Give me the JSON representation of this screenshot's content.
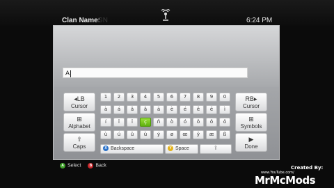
{
  "header": {
    "title": "Clan Name:",
    "ghost": "GN",
    "time": "6:24 PM"
  },
  "input": {
    "value": "A"
  },
  "sidebar_left": [
    {
      "icon": "◂LB",
      "label": "Cursor"
    },
    {
      "icon": "⊞",
      "label": "Alphabet"
    },
    {
      "icon": "⇧",
      "label": "Caps"
    }
  ],
  "sidebar_right": [
    {
      "icon": "RB▸",
      "label": "Cursor"
    },
    {
      "icon": "⊞",
      "label": "Symbols"
    },
    {
      "icon": "▶",
      "label": "Done"
    }
  ],
  "keys": [
    [
      "1",
      "2",
      "3",
      "4",
      "5",
      "6",
      "7",
      "8",
      "9",
      "0"
    ],
    [
      "à",
      "á",
      "â",
      "ã",
      "ä",
      "è",
      "é",
      "ê",
      "ë",
      "ì"
    ],
    [
      "í",
      "î",
      "ï",
      "ç",
      "ñ",
      "ò",
      "ó",
      "ô",
      "õ",
      "ö"
    ],
    [
      "ù",
      "ú",
      "û",
      "ü",
      "ý",
      "ø",
      "œ",
      "ÿ",
      "æ",
      "ß"
    ]
  ],
  "selected_key": "ç",
  "bottom_keys": {
    "backspace": "Backspace",
    "space": "Space",
    "extra": "ĩ"
  },
  "footer": {
    "select_label": "Select",
    "back_label": "Back"
  },
  "credits": {
    "line1": "Created By:",
    "line2": "www.YouTube.com/",
    "line3": "MrMcMods"
  },
  "colors": {
    "selected": "#6cc21a",
    "x_button": "#2a72c9",
    "y_button": "#e3b21b",
    "a_button": "#3fa12a",
    "b_button": "#c8262a"
  }
}
